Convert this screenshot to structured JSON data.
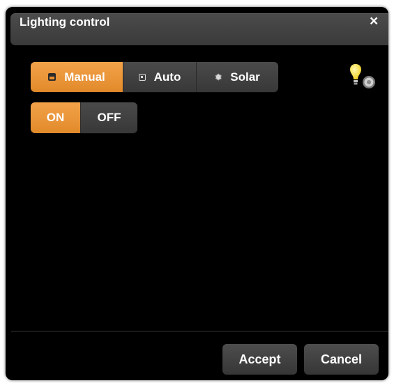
{
  "window": {
    "title": "Lighting control",
    "close_label": "×"
  },
  "mode": {
    "options": [
      {
        "label": "Manual",
        "icon": "manual-icon",
        "active": true
      },
      {
        "label": "Auto",
        "icon": "calendar-icon",
        "active": false
      },
      {
        "label": "Solar",
        "icon": "sun-icon",
        "active": false
      }
    ]
  },
  "power": {
    "on_label": "ON",
    "off_label": "OFF",
    "state": "ON"
  },
  "status_icon": "light-bulb-on-icon",
  "footer": {
    "accept_label": "Accept",
    "cancel_label": "Cancel"
  },
  "colors": {
    "accent": "#e8902e",
    "background": "#000000",
    "button": "#434343",
    "bulb": "#f5e04a"
  }
}
